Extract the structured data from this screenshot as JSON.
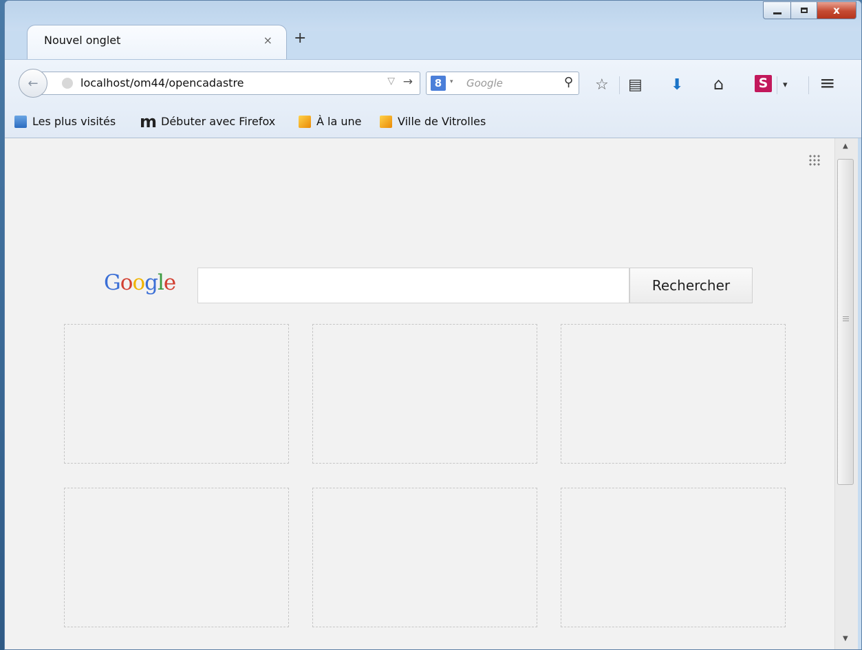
{
  "window": {
    "controls": {
      "minimize": "",
      "maximize": "",
      "close": "x"
    }
  },
  "tabs": [
    {
      "title": "Nouvel onglet",
      "close": "×",
      "active": true
    }
  ],
  "new_tab_label": "+",
  "nav": {
    "back_icon": "arrow-left-icon",
    "url": "localhost/om44/opencadastre",
    "url_dropdown_glyph": "▽",
    "go_glyph": "→"
  },
  "search": {
    "engine": "Google",
    "engine_glyph": "8",
    "engine_dropdown_glyph": "▾",
    "placeholder": "Google",
    "search_glyph": "⚲"
  },
  "toolbar": {
    "icons": [
      "star-icon",
      "reading-list-icon",
      "download-icon",
      "home-icon",
      "s-addon-icon",
      "menu-icon"
    ],
    "star": "☆",
    "reading": "▤",
    "download": "⬇",
    "home": "⌂",
    "addon": "S",
    "addon_dropdown": "▾",
    "menu": "≡"
  },
  "bookmarks": [
    {
      "label": "Les plus visités",
      "icon": "most-visited-icon"
    },
    {
      "label": "Débuter avec Firefox",
      "icon": "mozilla-m-icon",
      "icon_text": "m"
    },
    {
      "label": "À la une",
      "icon": "rss-icon"
    },
    {
      "label": "Ville de Vitrolles",
      "icon": "rss-icon"
    }
  ],
  "newtab_page": {
    "logo": {
      "p1": "G",
      "p2": "o",
      "p3": "o",
      "p4": "g",
      "p5": "l",
      "p6": "e"
    },
    "search_value": "",
    "search_button": "Rechercher",
    "tiles": 6
  },
  "colors": {
    "close_button": "#c54a32",
    "addon_icon": "#c2185b",
    "download_icon": "#1a73c7"
  }
}
